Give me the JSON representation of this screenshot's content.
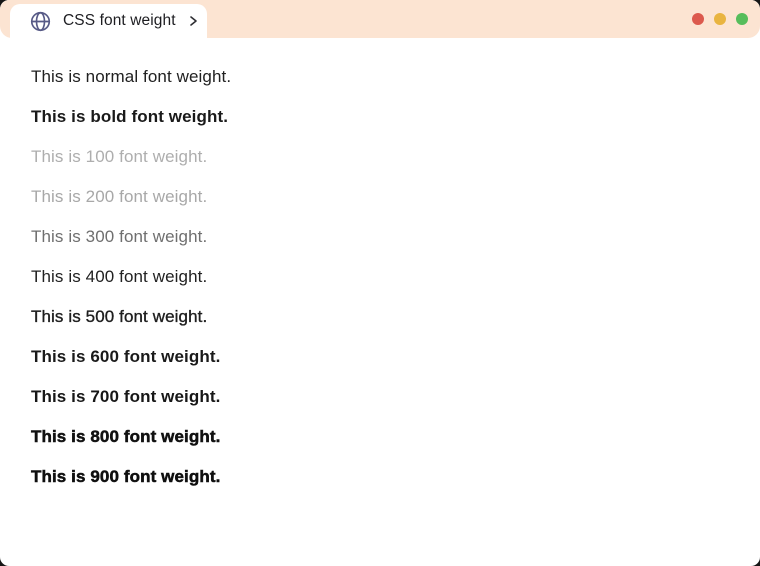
{
  "window": {
    "header": {
      "bg_color": "#fce4d2",
      "tab": {
        "title": "CSS font weight",
        "icon": "globe-icon",
        "icon_color": "#575a86",
        "chevron_icon": "chevron-right-icon"
      },
      "traffic_lights": [
        {
          "name": "red",
          "color": "#dc594d"
        },
        {
          "name": "yellow",
          "color": "#e9b440"
        },
        {
          "name": "green",
          "color": "#56bd5b"
        }
      ]
    },
    "body": {
      "default_text_color": "#212121",
      "lines": [
        {
          "text": "This is normal font weight.",
          "css_font_weight": "normal",
          "render_color": "#212121"
        },
        {
          "text": "This is bold font weight.",
          "css_font_weight": "bold",
          "render_color": "#1a1a1a"
        },
        {
          "text": "This is 100 font weight.",
          "css_font_weight": "100",
          "render_color": "#aeaeae"
        },
        {
          "text": "This is 200 font weight.",
          "css_font_weight": "200",
          "render_color": "#a8a8a8"
        },
        {
          "text": "This is 300 font weight.",
          "css_font_weight": "300",
          "render_color": "#6f6f6f"
        },
        {
          "text": "This is 400 font weight.",
          "css_font_weight": "400",
          "render_color": "#212121"
        },
        {
          "text": "This is 500 font weight.",
          "css_font_weight": "500",
          "render_color": "#1e1e1e"
        },
        {
          "text": "This is 600 font weight.",
          "css_font_weight": "600",
          "render_color": "#1a1a1a"
        },
        {
          "text": "This is 700 font weight.",
          "css_font_weight": "700",
          "render_color": "#171717"
        },
        {
          "text": "This is 800 font weight.",
          "css_font_weight": "800",
          "render_color": "#111111"
        },
        {
          "text": "This is 900 font weight.",
          "css_font_weight": "900",
          "render_color": "#0f0f0f"
        }
      ]
    }
  }
}
